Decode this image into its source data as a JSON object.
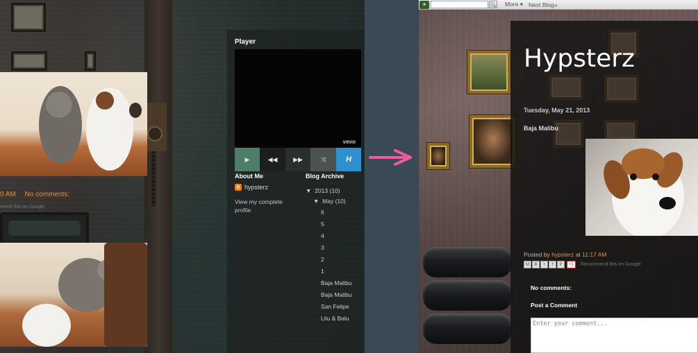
{
  "left": {
    "meta_time": "0 AM",
    "meta_comments": "No comments:",
    "reco_text": "mend this on Google",
    "player": {
      "title": "Player",
      "vevo": "vevo",
      "play_icon": "play-icon",
      "rewind_icon": "rewind-icon",
      "forward_icon": "fast-forward-icon",
      "shuffle_icon": "shuffle-icon",
      "h_label": "H"
    },
    "about": {
      "title": "About Me",
      "username": "hypsterz",
      "profile_link": "View my complete profile"
    },
    "archive": {
      "title": "Blog Archive",
      "year": "2013 (10)",
      "month": "May (10)",
      "items": [
        "6",
        "5",
        "4",
        "3",
        "2",
        "1",
        "Baja Malibu",
        "Baja Malibu",
        "San Felipe",
        "Lilu & Balu"
      ]
    }
  },
  "right": {
    "navbar": {
      "search_btn": "🔍",
      "more": "More ▾",
      "next_blog": "Next Blog»"
    },
    "blog_title": "Hypsterz",
    "post_date": "Tuesday, May 21, 2013",
    "post_title": "Baja Malibu",
    "posted_by_prefix": "Posted by",
    "posted_by_user": "hypsterz",
    "posted_at_word": "at",
    "posted_time": "11:17 AM",
    "share_plus": "+1",
    "share_reco": "Recommend this on Google",
    "no_comments": "No comments:",
    "post_comment": "Post a Comment",
    "comment_placeholder": "Enter your comment..."
  },
  "colors": {
    "accent_orange": "#e69138",
    "arrow_pink": "#ee5a9a",
    "player_play_green": "#4c7e6a",
    "player_h_blue": "#2e8fd2"
  }
}
